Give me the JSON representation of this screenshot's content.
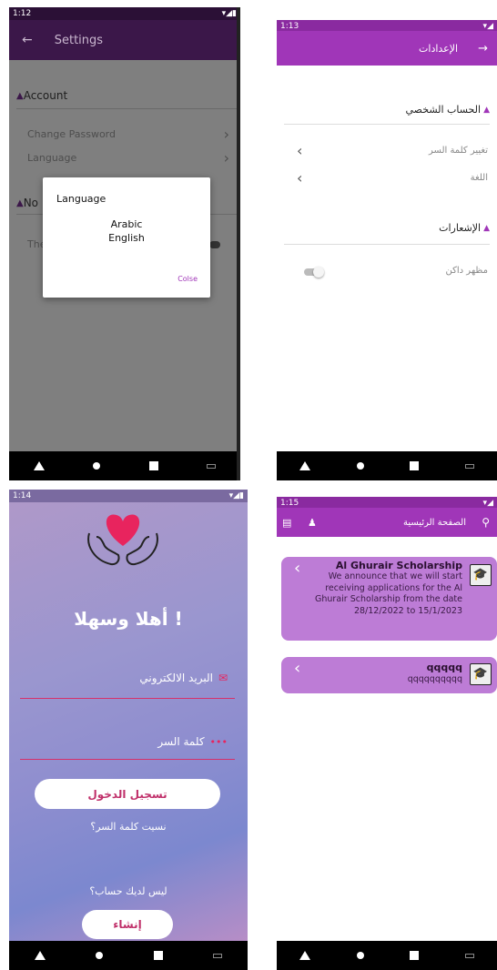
{
  "p1": {
    "status_time": "1:12",
    "title": "Settings",
    "account_header": "Account",
    "change_password": "Change Password",
    "language": "Language",
    "notifications_header_partial": "No",
    "theme_partial": "The",
    "dialog": {
      "title": "Language",
      "options": [
        "Arabic",
        "English"
      ],
      "close": "Colse"
    }
  },
  "p2": {
    "status_time": "1:13",
    "title": "الإعدادات",
    "account_header": "الحساب الشخصي",
    "change_password": "تغيير كلمة السر",
    "language": "اللغة",
    "notifications_header": "الإشعارات",
    "dark_mode": "مظهر داكن"
  },
  "p3": {
    "status_time": "1:14",
    "welcome": "أهلا وسهلا !",
    "email_label": "البريد الالكتروني",
    "password_label": "كلمة السر",
    "login_button": "تسجيل الدخول",
    "forgot_password": "نسيت كلمة السر؟",
    "no_account": "ليس لديك حساب؟",
    "create_button": "إنشاء"
  },
  "p4": {
    "status_time": "1:15",
    "title": "الصفحة الرئيسية",
    "cards": [
      {
        "title": "Al Ghurair Scholarship",
        "body": "We announce that we will start receiving applications for the Al Ghurair Scholarship from the date 28/12/2022 to 15/1/2023"
      },
      {
        "title": "qqqqq",
        "body": "qqqqqqqqqq"
      }
    ]
  },
  "colors": {
    "purple": "#a036b8",
    "dark_purple": "#3b1749",
    "pink": "#d6306a",
    "card": "#bd7cd6"
  }
}
